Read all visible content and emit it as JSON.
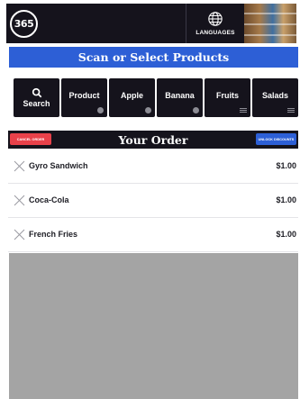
{
  "header": {
    "logo_text": "365",
    "languages_label": "LANGUAGES",
    "globe_icon": "globe-icon",
    "store_image": "store-shelves-photo"
  },
  "scan_bar": {
    "title": "Scan or Select Products"
  },
  "categories": [
    {
      "label": "Search",
      "icon": "search-icon"
    },
    {
      "label": "Product",
      "indicator": "dot"
    },
    {
      "label": "Apple",
      "indicator": "dot"
    },
    {
      "label": "Banana",
      "indicator": "dot"
    },
    {
      "label": "Fruits",
      "indicator": "lines"
    },
    {
      "label": "Salads",
      "indicator": "lines"
    }
  ],
  "order": {
    "title": "Your Order",
    "cancel_label": "CANCEL ORDER",
    "unlock_label": "UNLOCK DISCOUNTS",
    "items": [
      {
        "name": "Gyro Sandwich",
        "price": "$1.00"
      },
      {
        "name": "Coca-Cola",
        "price": "$1.00"
      },
      {
        "name": "French Fries",
        "price": "$1.00"
      }
    ]
  },
  "colors": {
    "dark": "#15131c",
    "blue": "#2d5fd6",
    "red": "#e8414a",
    "empty_area": "#a4a4a4"
  }
}
